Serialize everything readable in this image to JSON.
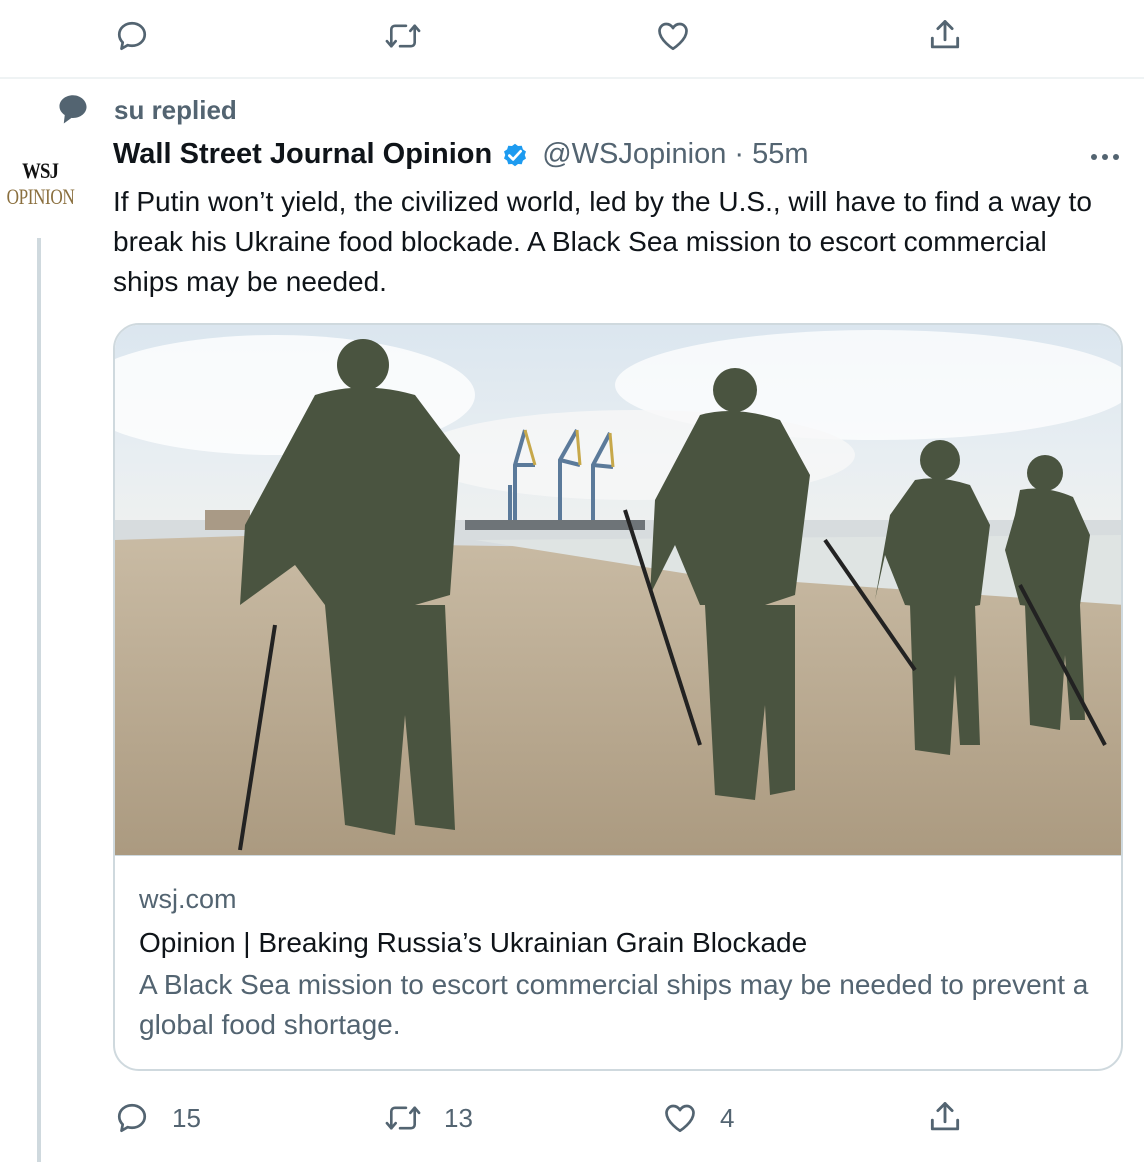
{
  "prev_actions": {
    "reply_icon": "reply-icon",
    "retweet_icon": "retweet-icon",
    "like_icon": "like-icon",
    "share_icon": "share-icon"
  },
  "social_context": {
    "icon": "speech-bubble-icon",
    "text": "su replied"
  },
  "avatar": {
    "line1": "WSJ",
    "line2": "OPINION"
  },
  "tweet": {
    "author_name": "Wall Street Journal Opinion",
    "verified_icon": "verified-badge-icon",
    "handle": "@WSJopinion",
    "separator": " · ",
    "time": "55m",
    "more_icon": "more-icon",
    "text": "If Putin won’t yield, the civilized world, led by the U.S., will have to find a way to break his Ukraine food blockade. A Black Sea mission to escort commercial ships may be needed."
  },
  "card": {
    "domain": "wsj.com",
    "title": "Opinion | Breaking Russia’s Ukrainian Grain Blockade",
    "description": "A Black Sea mission to escort commercial ships may be needed to prevent a global food shortage."
  },
  "actions": {
    "reply_count": "15",
    "retweet_count": "13",
    "like_count": "4"
  },
  "colors": {
    "text_primary": "#0f1419",
    "text_secondary": "#536471",
    "border": "#cfd9de",
    "verified": "#1d9bf0"
  }
}
